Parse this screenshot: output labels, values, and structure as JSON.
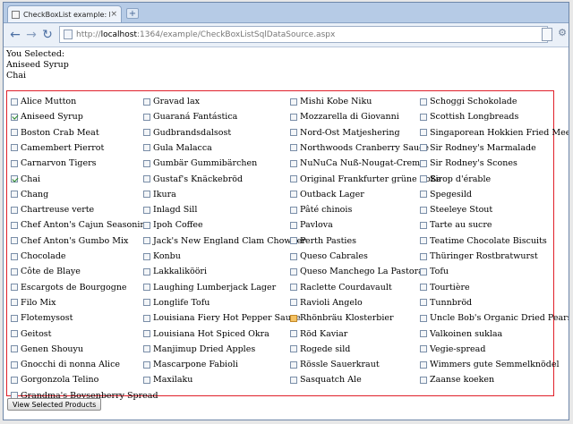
{
  "browser": {
    "tab_title": "CheckBoxList example: ho...",
    "url_scheme": "http://",
    "url_host": "localhost",
    "url_rest": ":1364/example/CheckBoxListSqlDataSource.aspx"
  },
  "selection": {
    "label": "You Selected:",
    "items": [
      "Aniseed Syrup",
      "Chai"
    ]
  },
  "products": {
    "columns": [
      [
        "Alice Mutton",
        "Aniseed Syrup",
        "Boston Crab Meat",
        "Camembert Pierrot",
        "Carnarvon Tigers",
        "Chai",
        "Chang",
        "Chartreuse verte",
        "Chef Anton's Cajun Seasoning",
        "Chef Anton's Gumbo Mix",
        "Chocolade",
        "Côte de Blaye",
        "Escargots de Bourgogne",
        "Filo Mix",
        "Flotemysost",
        "Geitost",
        "Genen Shouyu",
        "Gnocchi di nonna Alice",
        "Gorgonzola Telino",
        "Grandma's Boysenberry Spread"
      ],
      [
        "Gravad lax",
        "Guaraná Fantástica",
        "Gudbrandsdalsost",
        "Gula Malacca",
        "Gumbär Gummibärchen",
        "Gustaf's Knäckebröd",
        "Ikura",
        "Inlagd Sill",
        "Ipoh Coffee",
        "Jack's New England Clam Chowder",
        "Konbu",
        "Lakkalikööri",
        "Laughing Lumberjack Lager",
        "Longlife Tofu",
        "Louisiana Fiery Hot Pepper Sauce",
        "Louisiana Hot Spiced Okra",
        "Manjimup Dried Apples",
        "Mascarpone Fabioli",
        "Maxilaku"
      ],
      [
        "Mishi Kobe Niku",
        "Mozzarella di Giovanni",
        "Nord-Ost Matjeshering",
        "Northwoods Cranberry Sauce",
        "NuNuCa Nuß-Nougat-Creme",
        "Original Frankfurter grüne Soße",
        "Outback Lager",
        "Pâté chinois",
        "Pavlova",
        "Perth Pasties",
        "Queso Cabrales",
        "Queso Manchego La Pastora",
        "Raclette Courdavault",
        "Ravioli Angelo",
        "Rhönbräu Klosterbier",
        "Röd Kaviar",
        "Rogede sild",
        "Rössle Sauerkraut",
        "Sasquatch Ale"
      ],
      [
        "Schoggi Schokolade",
        "Scottish Longbreads",
        "Singaporean Hokkien Fried Mee",
        "Sir Rodney's Marmalade",
        "Sir Rodney's Scones",
        "Sirop d'érable",
        "Spegesild",
        "Steeleye Stout",
        "Tarte au sucre",
        "Teatime Chocolate Biscuits",
        "Thüringer Rostbratwurst",
        "Tofu",
        "Tourtière",
        "Tunnbröd",
        "Uncle Bob's Organic Dried Pears",
        "Valkoinen suklaa",
        "Vegie-spread",
        "Wimmers gute Semmelknödel",
        "Zaanse koeken"
      ]
    ],
    "checked": [
      "Aniseed Syrup",
      "Chai"
    ],
    "hovered": [
      "Rhönbräu Klosterbier"
    ]
  },
  "actions": {
    "view_selected_label": "View Selected Products"
  }
}
